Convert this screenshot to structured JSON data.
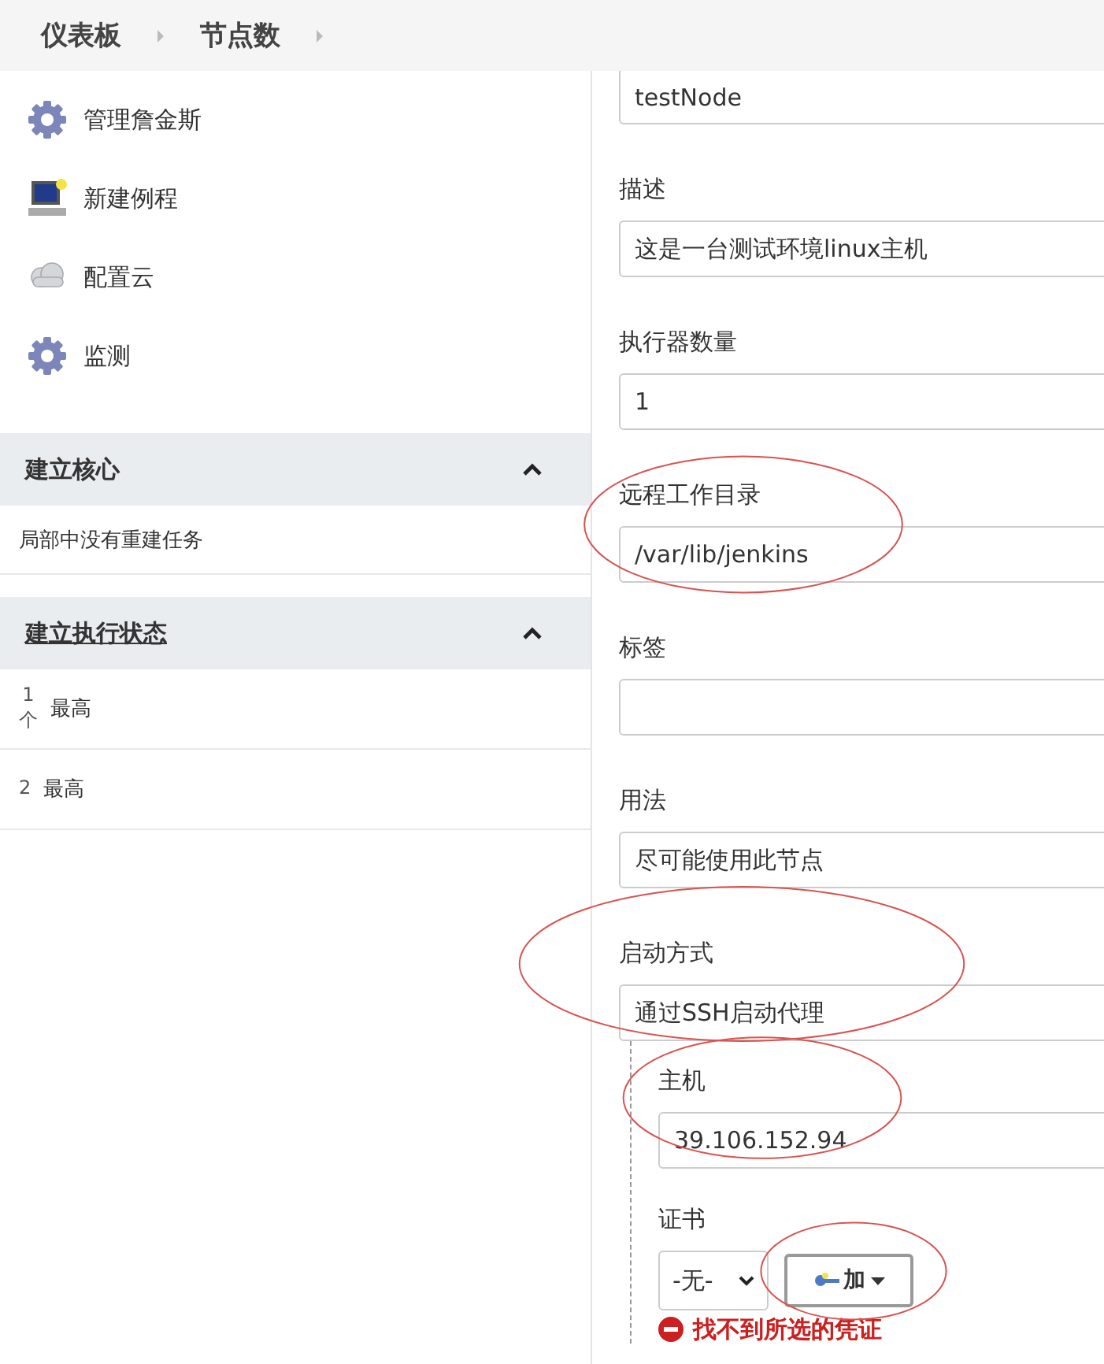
{
  "breadcrumbs": [
    {
      "label": "仪表板"
    },
    {
      "label": "节点数"
    }
  ],
  "sidebar": {
    "items": [
      {
        "label": "管理詹金斯",
        "kind": "gear"
      },
      {
        "label": "新建例程",
        "kind": "computer"
      },
      {
        "label": "配置云",
        "kind": "cloud"
      },
      {
        "label": "监测",
        "kind": "gear"
      }
    ]
  },
  "panels": [
    {
      "title": "建立核心",
      "expanded": true,
      "underlined": false,
      "message": "局部中没有重建任务"
    },
    {
      "title": "建立执行状态",
      "expanded": true,
      "underlined": true,
      "executors": [
        {
          "number": "1",
          "unit": "个",
          "status": "最高"
        },
        {
          "number": "2",
          "status": "最高"
        }
      ]
    }
  ],
  "form": {
    "fields": [
      {
        "kind": "input",
        "value": "testNode",
        "circled": false
      },
      {
        "kind": "input",
        "label": "描述",
        "value": "这是一台测试环境linux主机",
        "circled": false
      },
      {
        "kind": "input",
        "label": "执行器数量",
        "value": "1",
        "circled": false
      },
      {
        "kind": "input",
        "label": "远程工作目录",
        "value": "/var/lib/jenkins",
        "circled": true
      },
      {
        "kind": "input",
        "label": "标签",
        "circled": false
      },
      {
        "kind": "select",
        "label": "用法",
        "value": "尽可能使用此节点",
        "circled": false
      },
      {
        "kind": "select",
        "label": "启动方式",
        "value": "通过SSH启动代理",
        "circled": true
      }
    ],
    "launch": {
      "host": {
        "label": "主机",
        "value": "39.106.152.94",
        "circled": true
      },
      "credentials": {
        "label": "证书",
        "value": "-无-",
        "add_button": "加",
        "add_circled": true,
        "error": "找不到所选的凭证"
      }
    }
  }
}
